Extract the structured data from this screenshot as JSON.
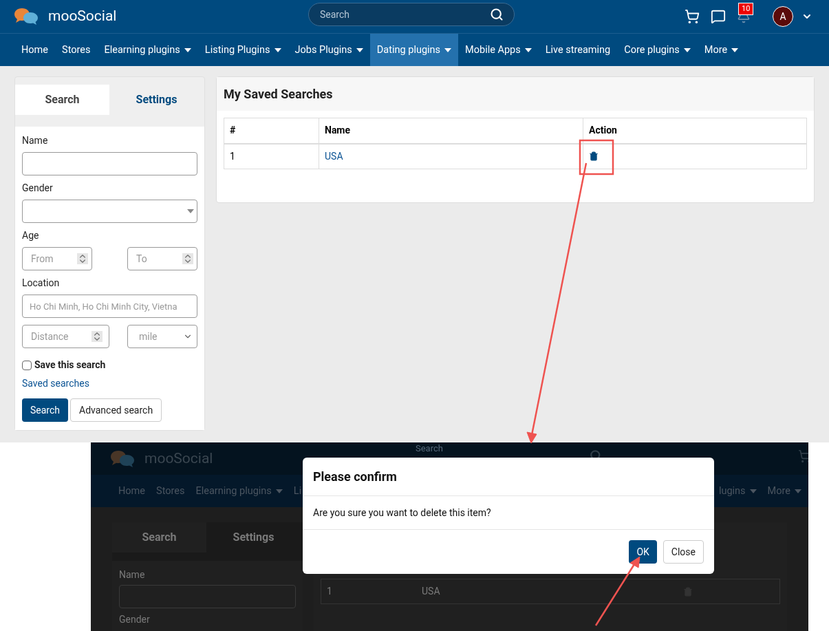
{
  "header": {
    "logo": "mooSocial",
    "search": {
      "placeholder": "Search"
    },
    "notification_count": "10",
    "avatar": "A"
  },
  "nav": [
    {
      "label": "Home",
      "dropdown": false,
      "selected": false
    },
    {
      "label": "Stores",
      "dropdown": false,
      "selected": false
    },
    {
      "label": "Elearning plugins",
      "dropdown": true,
      "selected": false
    },
    {
      "label": "Listing Plugins",
      "dropdown": true,
      "selected": false
    },
    {
      "label": "Jobs Plugins",
      "dropdown": true,
      "selected": false
    },
    {
      "label": "Dating plugins",
      "dropdown": true,
      "selected": true
    },
    {
      "label": "Mobile Apps",
      "dropdown": true,
      "selected": false
    },
    {
      "label": "Live streaming",
      "dropdown": false,
      "selected": false
    },
    {
      "label": "Core plugins",
      "dropdown": true,
      "selected": false
    },
    {
      "label": "More",
      "dropdown": true,
      "selected": false
    }
  ],
  "search_panel": {
    "tabs": [
      {
        "label": "Search",
        "selected": true
      },
      {
        "label": "Settings",
        "selected": false
      }
    ],
    "name_label": "Name",
    "gender_label": "Gender",
    "age_label": "Age",
    "age_from": {
      "placeholder": "From"
    },
    "age_to": {
      "placeholder": "To"
    },
    "location_label": "Location",
    "location": {
      "placeholder": "Ho Chi Minh, Ho Chi Minh City, Vietna"
    },
    "distance": {
      "placeholder": "Distance"
    },
    "unit": "mile",
    "save_search": {
      "label": "Save this search",
      "checked": false
    },
    "saved_link": "Saved searches",
    "buttons": [
      "Search",
      "Advanced search"
    ]
  },
  "saved_searches": {
    "title": "My Saved Searches",
    "columns": [
      "#",
      "Name",
      "Action"
    ],
    "rows": [
      {
        "index": "1",
        "name": "USA"
      }
    ]
  },
  "second_screen": {
    "logo": "mooSocial",
    "search_placeholder": "Search",
    "nav_left": [
      {
        "label": "Home",
        "dropdown": false
      },
      {
        "label": "Stores",
        "dropdown": false
      },
      {
        "label": "Elearning plugins",
        "dropdown": true
      },
      {
        "label": "Li",
        "dropdown": false
      }
    ],
    "nav_right": [
      {
        "label": "lugins",
        "dropdown": true
      },
      {
        "label": "More",
        "dropdown": true
      }
    ],
    "tabs": [
      "Search",
      "Settings"
    ],
    "labels": [
      "Name",
      "Gender"
    ],
    "row": [
      "1",
      "USA"
    ],
    "dialog": {
      "title": "Please confirm",
      "message": "Are you sure you want to delete this item?",
      "buttons": [
        {
          "label": "OK",
          "kind": "primary"
        },
        {
          "label": "Close",
          "kind": "secondary"
        }
      ]
    }
  }
}
